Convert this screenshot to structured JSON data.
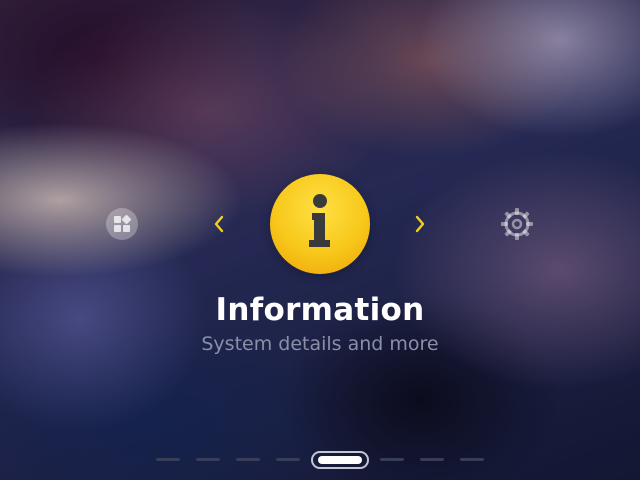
{
  "menu": {
    "title": "Information",
    "subtitle": "System details and more",
    "current_icon": "info-icon",
    "prev_icon": "apps-icon",
    "next_icon": "gear-icon",
    "accent_color": "#f5c518",
    "arrow_color": "#f2d21a"
  },
  "pager": {
    "page_count": 8,
    "active_index": 4
  }
}
